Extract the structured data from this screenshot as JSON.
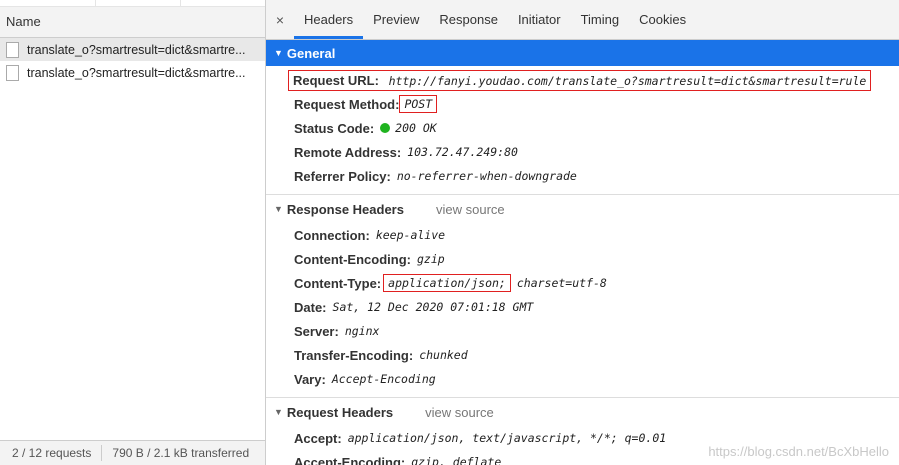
{
  "left": {
    "column_header": "Name",
    "requests": [
      {
        "name": "translate_o?smartresult=dict&smartre..."
      },
      {
        "name": "translate_o?smartresult=dict&smartre..."
      }
    ],
    "status_requests": "2 / 12 requests",
    "status_transferred": "790 B / 2.1 kB transferred"
  },
  "tabs": {
    "close": "×",
    "items": [
      "Headers",
      "Preview",
      "Response",
      "Initiator",
      "Timing",
      "Cookies"
    ],
    "active": "Headers"
  },
  "general": {
    "title": "General",
    "request_url_label": "Request URL:",
    "request_url": "http://fanyi.youdao.com/translate_o?smartresult=dict&smartresult=rule",
    "request_method_label": "Request Method:",
    "request_method": "POST",
    "status_code_label": "Status Code:",
    "status_code": "200 OK",
    "remote_address_label": "Remote Address:",
    "remote_address": "103.72.47.249:80",
    "referrer_policy_label": "Referrer Policy:",
    "referrer_policy": "no-referrer-when-downgrade"
  },
  "response_headers": {
    "title": "Response Headers",
    "view_source": "view source",
    "connection_label": "Connection:",
    "connection": "keep-alive",
    "content_encoding_label": "Content-Encoding:",
    "content_encoding": "gzip",
    "content_type_label": "Content-Type:",
    "content_type_main": "application/json;",
    "content_type_rest": "charset=utf-8",
    "date_label": "Date:",
    "date": "Sat, 12 Dec 2020 07:01:18 GMT",
    "server_label": "Server:",
    "server": "nginx",
    "transfer_encoding_label": "Transfer-Encoding:",
    "transfer_encoding": "chunked",
    "vary_label": "Vary:",
    "vary": "Accept-Encoding"
  },
  "request_headers": {
    "title": "Request Headers",
    "view_source": "view source",
    "accept_label": "Accept:",
    "accept": "application/json, text/javascript, */*; q=0.01",
    "accept_encoding_label": "Accept-Encoding:",
    "accept_encoding": "gzip, deflate"
  },
  "watermark": "https://blog.csdn.net/BcXbHello",
  "colors": {
    "accent": "#1a73e8",
    "highlight_box": "#e02020",
    "status_ok": "#1fb31f"
  }
}
